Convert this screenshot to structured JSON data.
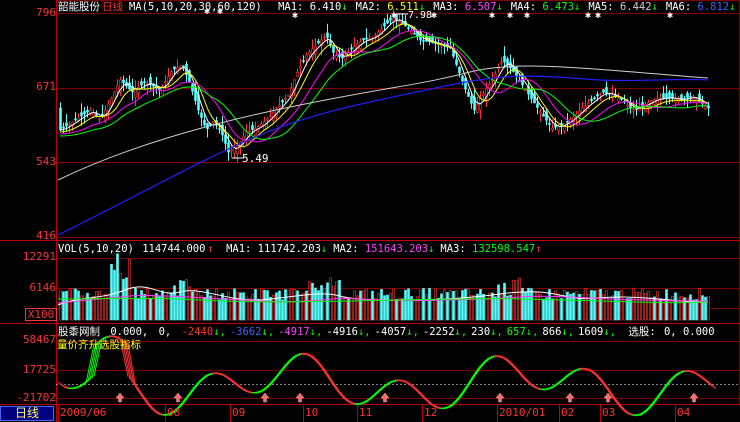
{
  "colors": {
    "up": "#ff3232",
    "down": "#54ffff",
    "grid": "#7f0000",
    "ma5": "#ffffff",
    "ma10": "#ffff00",
    "ma20": "#ff00ff",
    "ma30": "#00ff00",
    "ma60": "#d0d0d0",
    "ma120": "#2020ff",
    "axis": "#ff3232"
  },
  "main": {
    "stock_name": "韶能股份",
    "period": "日线",
    "ma_params": "MA(5,10,20,30,60,120)",
    "ma": [
      {
        "label": "MA1:",
        "value": "6.410",
        "arrow": "↓",
        "color": "#ffffff"
      },
      {
        "label": "MA2:",
        "value": "6.511",
        "arrow": "↓",
        "color": "#ffff00"
      },
      {
        "label": "MA3:",
        "value": "6.507",
        "arrow": "↓",
        "color": "#ff40ff"
      },
      {
        "label": "MA4:",
        "value": "6.473",
        "arrow": "↓",
        "color": "#00ff00"
      },
      {
        "label": "MA5:",
        "value": "6.442",
        "arrow": "↓",
        "color": "#d0d0d0"
      },
      {
        "label": "MA6:",
        "value": "6.812",
        "arrow": "↓",
        "color": "#4060ff"
      }
    ],
    "y_labels": [
      "796",
      "671",
      "543",
      "416"
    ],
    "high_label": "7.98",
    "low_label": "5.49"
  },
  "volume": {
    "params": "VOL(5,10,20)",
    "value": "114744.000",
    "value_arrow": "↑",
    "ma": [
      {
        "label": "MA1:",
        "value": "111742.203",
        "arrow": "↓",
        "color": "#ffffff"
      },
      {
        "label": "MA2:",
        "value": "151643.203",
        "arrow": "↓",
        "color": "#ff40ff"
      },
      {
        "label": "MA3:",
        "value": "132598.547",
        "arrow": "↑",
        "color": "#00ff00"
      }
    ],
    "y_labels": [
      "12291",
      "6146"
    ],
    "unit": "X100"
  },
  "indicator": {
    "name": "股黍网制",
    "values": [
      {
        "text": "0.000,",
        "arrow": "",
        "color": "#ffffff"
      },
      {
        "text": "0,",
        "arrow": "",
        "color": "#ffffff"
      },
      {
        "text": "-2440",
        "arrow": "↓",
        "color": "#ff3232"
      },
      {
        "text": "-3662",
        "arrow": "↓",
        "color": "#4060ff"
      },
      {
        "text": "-4917",
        "arrow": "↓",
        "color": "#ff40ff"
      },
      {
        "text": "-4916",
        "arrow": "↓",
        "color": "#ffffff"
      },
      {
        "text": "-4057",
        "arrow": "↓",
        "color": "#ffffff"
      },
      {
        "text": "-2252",
        "arrow": "↓",
        "color": "#ffffff"
      },
      {
        "text": "230",
        "arrow": "↓",
        "color": "#ffffff"
      },
      {
        "text": "657",
        "arrow": "↓",
        "color": "#00ff00"
      },
      {
        "text": "866",
        "arrow": "↓",
        "color": "#ffffff"
      },
      {
        "text": "1609",
        "arrow": "↓",
        "color": "#ffffff"
      }
    ],
    "select_label": "选股:",
    "select_value": "0, 0.000",
    "subtitle": "量价齐升选股指标",
    "y_labels": [
      "58467",
      "17725",
      "-21702"
    ]
  },
  "x_axis": {
    "labels": [
      "2009/06",
      "08",
      "09",
      "10",
      "11",
      "12",
      "2010/01",
      "02",
      "03",
      "04"
    ]
  },
  "period_tab": "日线"
}
